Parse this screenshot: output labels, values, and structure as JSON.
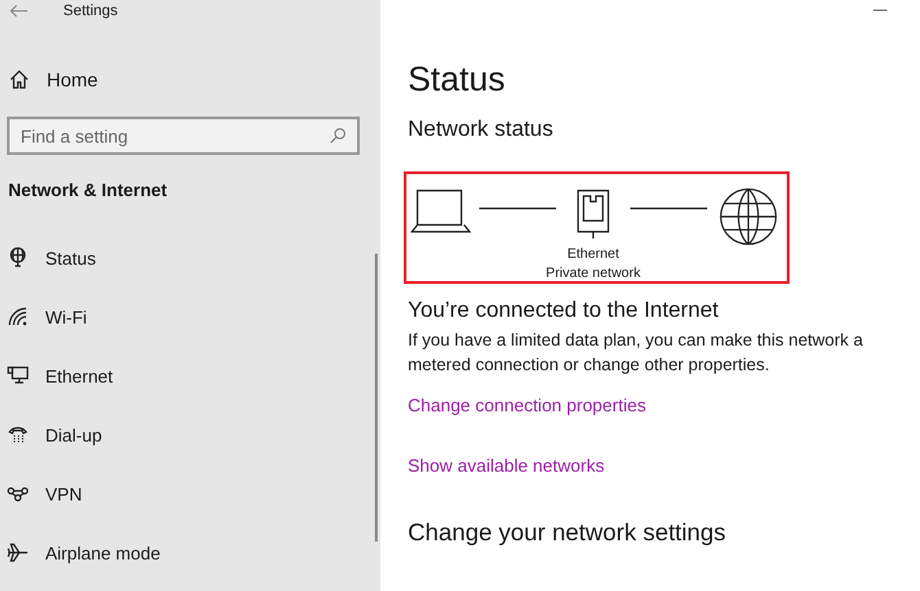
{
  "window": {
    "title": "Settings"
  },
  "sidebar": {
    "home": "Home",
    "search": {
      "placeholder": "Find a setting"
    },
    "section": "Network & Internet",
    "items": [
      {
        "label": "Status",
        "kind": "status"
      },
      {
        "label": "Wi-Fi",
        "kind": "wifi"
      },
      {
        "label": "Ethernet",
        "kind": "ethernet"
      },
      {
        "label": "Dial-up",
        "kind": "dialup"
      },
      {
        "label": "VPN",
        "kind": "vpn"
      },
      {
        "label": "Airplane mode",
        "kind": "airplane"
      }
    ]
  },
  "main": {
    "title": "Status",
    "network_status": {
      "heading": "Network status",
      "highlighted": true,
      "adapter": "Ethernet",
      "network": "Private network"
    },
    "connection": {
      "heading": "You’re connected to the Internet",
      "text": "If you have a limited data plan, you can make this network a metered connection or change other properties."
    },
    "links": [
      "Change connection properties",
      "Show available networks"
    ],
    "next_heading": "Change your network settings"
  }
}
